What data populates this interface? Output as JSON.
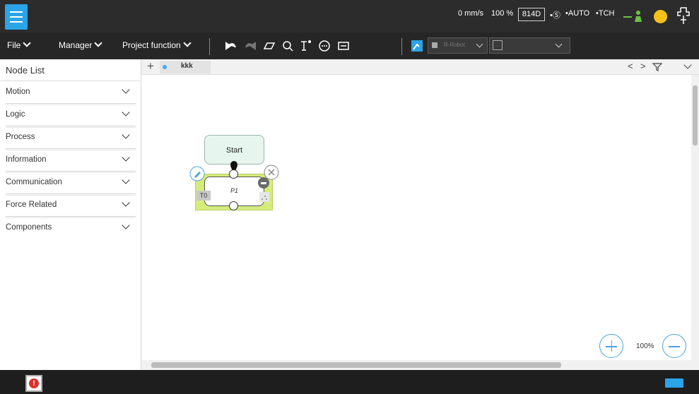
{
  "status": {
    "speed": "0 mm/s",
    "percent": "100 %",
    "code": "814D",
    "safety": "•Ⓢ",
    "mode": "•AUTO",
    "tool": "•TCH"
  },
  "menu": {
    "file": "File",
    "manager": "Manager",
    "project_function": "Project function",
    "robot_select": "R-Robot"
  },
  "sidebar": {
    "title": "Node List",
    "items": [
      {
        "label": "Motion"
      },
      {
        "label": "Logic"
      },
      {
        "label": "Process"
      },
      {
        "label": "Information"
      },
      {
        "label": "Communication"
      },
      {
        "label": "Force Related"
      },
      {
        "label": "Components"
      }
    ]
  },
  "tabs": {
    "add": "+",
    "active": "kkk",
    "prev": "<",
    "next": ">"
  },
  "flow": {
    "start_label": "Start",
    "p1_label": "P1",
    "tool_tag": "T0"
  },
  "zoom": {
    "level": "100%"
  },
  "colors": {
    "accent": "#2ba4e8",
    "node_highlight": "#d4ec7c",
    "start_fill": "#e6f6ef",
    "status_indicator": "#f6c119",
    "alarm": "#d9302c"
  }
}
